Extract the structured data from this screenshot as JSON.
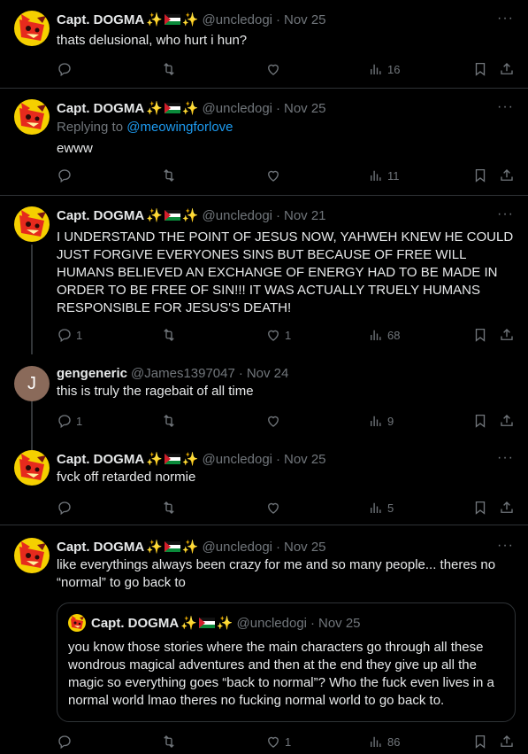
{
  "tweets": [
    {
      "name": "Capt. DOGMA",
      "handle": "@uncledogi",
      "date": "Nov 25",
      "text": "thats delusional, who hurt i hun?",
      "replies": "",
      "likes": "",
      "views": "16"
    },
    {
      "name": "Capt. DOGMA",
      "handle": "@uncledogi",
      "date": "Nov 25",
      "reply_prefix": "Replying to",
      "reply_to": "@meowingforlove",
      "text": "ewww",
      "replies": "",
      "likes": "",
      "views": "11"
    },
    {
      "name": "Capt. DOGMA",
      "handle": "@uncledogi",
      "date": "Nov 21",
      "text": "I UNDERSTAND THE POINT OF JESUS NOW, YAHWEH KNEW HE COULD JUST FORGIVE EVERYONES SINS BUT BECAUSE OF FREE WILL HUMANS BELIEVED AN EXCHANGE OF ENERGY HAD TO BE MADE IN ORDER TO BE FREE OF SIN!!! IT WAS ACTUALLY TRUELY HUMANS RESPONSIBLE FOR JESUS'S DEATH!",
      "replies": "1",
      "likes": "1",
      "views": "68"
    },
    {
      "name": "gengeneric",
      "handle": "@James1397047",
      "date": "Nov 24",
      "avatar_letter": "J",
      "text": "this is truly the ragebait of all time",
      "replies": "1",
      "likes": "",
      "views": "9"
    },
    {
      "name": "Capt. DOGMA",
      "handle": "@uncledogi",
      "date": "Nov 25",
      "text": "fvck off retarded normie",
      "replies": "",
      "likes": "",
      "views": "5"
    },
    {
      "name": "Capt. DOGMA",
      "handle": "@uncledogi",
      "date": "Nov 25",
      "text": "like everythings always been crazy for me and so many people... theres no “normal” to go back to",
      "replies": "",
      "likes": "1",
      "views": "86",
      "quote": {
        "name": "Capt. DOGMA",
        "handle": "@uncledogi",
        "date": "Nov 25",
        "text": "you know those stories where the main characters go through all these wondrous magical adventures and then at the end they give up all the magic so everything goes “back to normal”? Who the fuck even lives in a normal world lmao theres no fucking normal world to go back to."
      }
    }
  ],
  "separator": "·",
  "sparkle": "✨",
  "more_glyph": "···",
  "colors": {
    "background": "#000000",
    "text": "#e7e9ea",
    "muted": "#71767b",
    "link": "#1d9bf0",
    "divider": "#2f3336"
  },
  "icons": [
    "reply-icon",
    "retweet-icon",
    "like-icon",
    "views-icon",
    "bookmark-icon",
    "share-icon",
    "more-icon"
  ]
}
